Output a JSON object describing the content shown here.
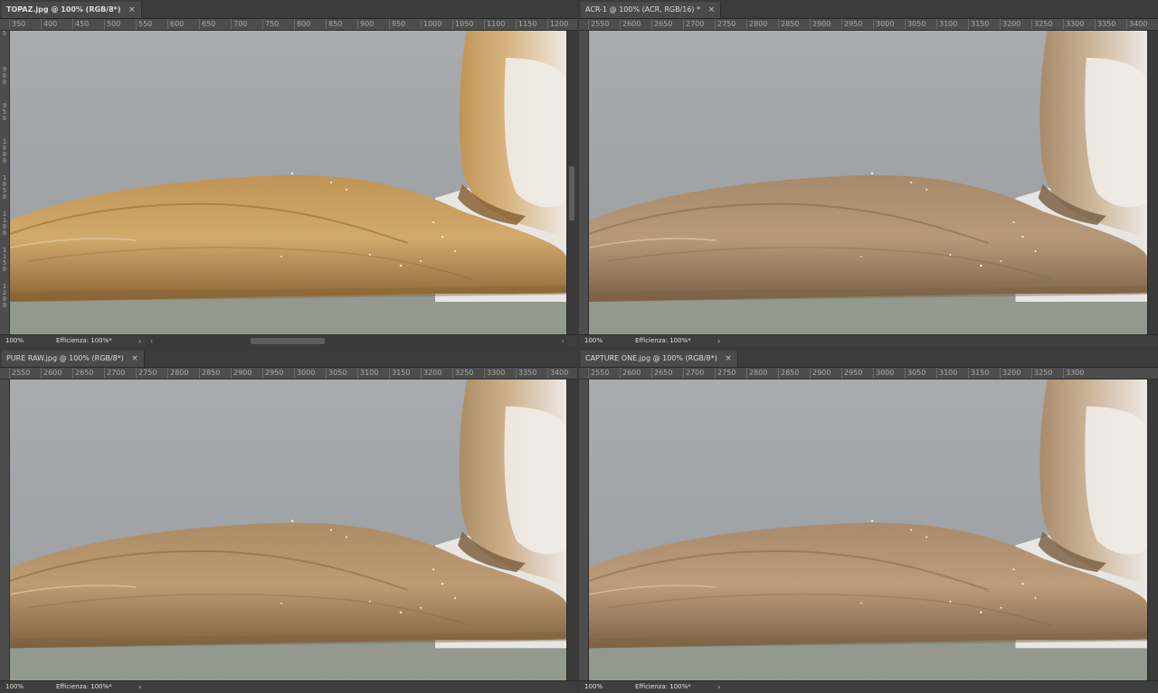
{
  "documents": [
    {
      "tab_title": "TOPAZ.jpg @ 100% (RGB/8*)",
      "close": "×",
      "zoom": "100%",
      "status": "Efficienza: 100%*",
      "ruler_ticks": [
        "350",
        "400",
        "450",
        "500",
        "550",
        "600",
        "650",
        "700",
        "750",
        "800",
        "850",
        "900",
        "950",
        "1000",
        "1050",
        "1100",
        "1150",
        "1200"
      ],
      "left_ruler": [
        "5",
        "9 0 0",
        "9 5 0",
        "1 0 0 0",
        "1 0 5 0",
        "1 1 0 0",
        "1 1 5 0",
        "1 2 0 0"
      ],
      "tone": {
        "base": "#d2aa6c",
        "mid": "#c09457",
        "dark": "#8a6336",
        "neck": "#d8b47f"
      }
    },
    {
      "tab_title": "ACR-1 @ 100% (ACR, RGB/16) *",
      "close": "×",
      "zoom": "100%",
      "status": "Efficienza: 100%*",
      "ruler_ticks": [
        "2550",
        "2600",
        "2650",
        "2700",
        "2750",
        "2800",
        "2850",
        "2900",
        "2950",
        "3000",
        "3050",
        "3100",
        "3150",
        "3200",
        "3250",
        "3300",
        "3350",
        "3400"
      ],
      "tone": {
        "base": "#b79a7a",
        "mid": "#a68a6a",
        "dark": "#7b6246",
        "neck": "#c9b193"
      }
    },
    {
      "tab_title": "PURE RAW.jpg @ 100% (RGB/8*)",
      "close": "×",
      "zoom": "100%",
      "status": "Efficienza: 100%*",
      "ruler_ticks": [
        "2550",
        "2600",
        "2650",
        "2700",
        "2750",
        "2800",
        "2850",
        "2900",
        "2950",
        "3000",
        "3050",
        "3100",
        "3150",
        "3200",
        "3250",
        "3300",
        "3350",
        "3400"
      ],
      "tone": {
        "base": "#bd9c73",
        "mid": "#ab8c64",
        "dark": "#7d6141",
        "neck": "#cdb08b"
      }
    },
    {
      "tab_title": "CAPTURE ONE.jpg @ 100% (RGB/8*)",
      "close": "×",
      "zoom": "100%",
      "status": "Efficienza: 100%*",
      "ruler_ticks": [
        "2550",
        "2600",
        "2650",
        "2700",
        "2750",
        "2800",
        "2850",
        "2900",
        "2950",
        "3000",
        "3050",
        "3100",
        "3150",
        "3200",
        "3250",
        "3300"
      ],
      "tone": {
        "base": "#bb9c7b",
        "mid": "#a98b6b",
        "dark": "#7c6347",
        "neck": "#ccb396"
      }
    }
  ],
  "icons": {
    "scroll_right": "›",
    "scroll_left": "‹"
  },
  "colors": {
    "water_top": "#a9abae",
    "water_bottom": "#9aa097"
  }
}
